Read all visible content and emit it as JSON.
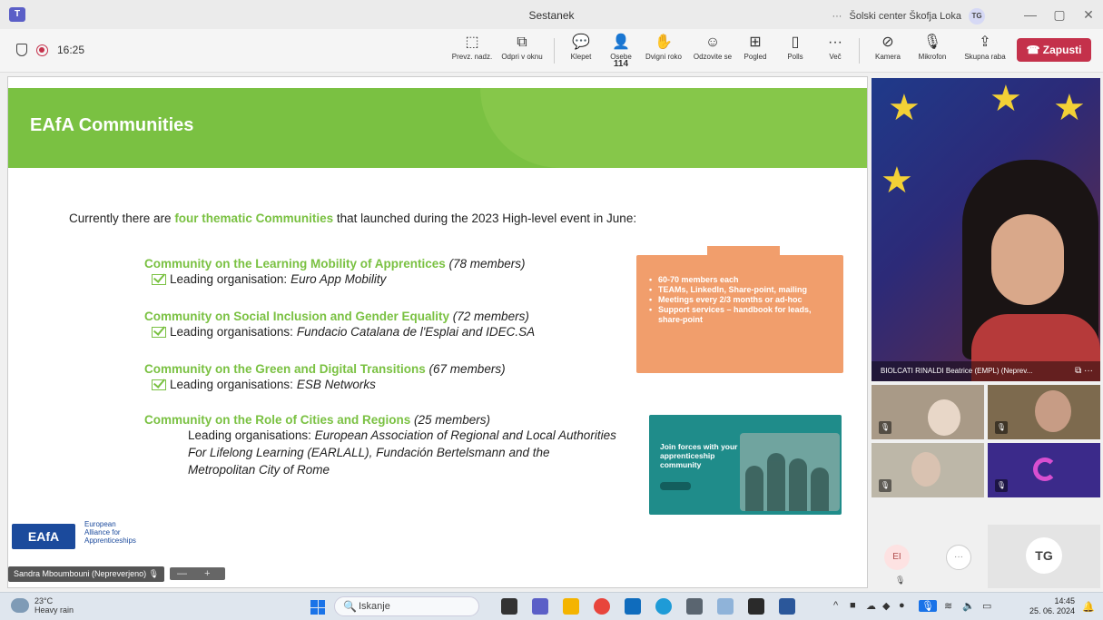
{
  "window": {
    "title": "Sestanek",
    "org_name": "Šolski center Škofja Loka",
    "org_badge": "TG",
    "more": "···",
    "minimize": "—",
    "restore": "▢",
    "close": "✕"
  },
  "toolbar": {
    "time": "16:25",
    "buttons": [
      {
        "label": "Prevz. nadz.",
        "icon": "⬚"
      },
      {
        "label": "Odpri v oknu",
        "icon": "⧉"
      },
      {
        "label": "Klepet",
        "icon": "💬"
      },
      {
        "label": "Osebe",
        "icon": "👤",
        "count": "114"
      },
      {
        "label": "Dvigni roko",
        "icon": "✋"
      },
      {
        "label": "Odzovite se",
        "icon": "☺"
      },
      {
        "label": "Pogled",
        "icon": "⊞"
      },
      {
        "label": "Polls",
        "icon": "▯"
      },
      {
        "label": "Več",
        "icon": "···"
      }
    ],
    "media": [
      {
        "label": "Kamera",
        "icon": "⊘"
      },
      {
        "label": "Mikrofon",
        "icon": "🎙"
      },
      {
        "label": "Skupna raba",
        "icon": "⇪"
      }
    ],
    "leave_label": "Zapusti"
  },
  "slide": {
    "title": "EAfA Communities",
    "intro_before": "Currently there are ",
    "intro_highlight": "four thematic Communities",
    "intro_after": " that launched during the 2023 High-level event in June:",
    "communities": [
      {
        "name": "Community on the Learning Mobility of Apprentices",
        "members": " (78 members)",
        "lead_prefix": "Leading organisation: ",
        "lead": "Euro App Mobility"
      },
      {
        "name": "Community on Social Inclusion and Gender Equality",
        "members": " (72 members)",
        "lead_prefix": "Leading organisations: ",
        "lead": "Fundacio Catalana de l'Esplai  and IDEC.SA"
      },
      {
        "name": "Community on the Green and Digital Transitions",
        "members": " (67 members)",
        "lead_prefix": "Leading organisations: ",
        "lead": "ESB Networks"
      },
      {
        "name": "Community on the Role of Cities and Regions",
        "members": " (25 members)",
        "lead_prefix": "Leading organisations: ",
        "lead": "European Association of Regional and Local Authorities For Lifelong Learning (EARLALL), Fundación Bertelsmann and the Metropolitan City of Rome"
      }
    ],
    "box_items": [
      "60-70 members each",
      "TEAMs, LinkedIn, Share-point, mailing",
      "Meetings every 2/3 months or ad-hoc",
      "Support services – handbook for leads, share-point"
    ],
    "promo_text": "Join forces with your apprenticeship community",
    "logo": "EAfA",
    "logo_sub": [
      "European",
      "Alliance for",
      "Apprenticeships"
    ]
  },
  "presenter": {
    "name": "Sandra Mboumbouni (Nepreverjeno)",
    "zoom": "— +"
  },
  "participants": {
    "main_name": "BIOLCATI RINALDI Beatrice (EMPL) (Neprev...",
    "ei": "EI",
    "more": "···",
    "tg": "TG"
  },
  "taskbar": {
    "temp": "23°C",
    "weather": "Heavy rain",
    "search": "Iskanje",
    "time": "14:45",
    "date": "25. 06. 2024"
  },
  "colors": {
    "green": "#7ac142",
    "orange": "#f19e6c",
    "leave": "#c4314b",
    "eafa_blue": "#1b4a9c"
  }
}
